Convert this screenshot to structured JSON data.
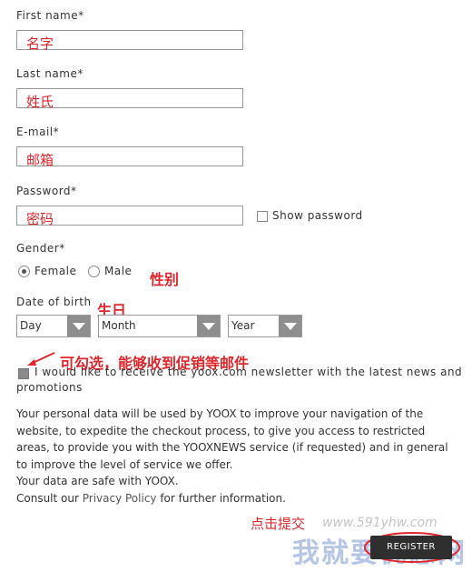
{
  "form": {
    "first_name": {
      "label": "First name*",
      "annotation": "名字"
    },
    "last_name": {
      "label": "Last name*",
      "annotation": "姓氏"
    },
    "email": {
      "label": "E-mail*",
      "annotation": "邮箱"
    },
    "password": {
      "label": "Password*",
      "annotation": "密码",
      "show_password_label": "Show password"
    },
    "gender": {
      "label": "Gender*",
      "options": [
        "Female",
        "Male"
      ],
      "selected": "Female",
      "annotation": "性别"
    },
    "dob": {
      "label": "Date of birth",
      "annotation": "生日",
      "day": "Day",
      "month": "Month",
      "year": "Year"
    },
    "newsletter": {
      "annotation": "可勾选，能够收到促销等邮件",
      "label_line1": "I would like to receive the yoox.com newsletter with the latest news and",
      "label_line2": "promotions"
    },
    "privacy": {
      "lines": [
        "Your personal data will be used by YOOX to improve your navigation of the",
        "website, to expedite the checkout process, to give you access to restricted",
        "areas, to provide you with the YOOXNEWS service (if requested) and in general",
        "to improve the level of service we offer.",
        "Your data are safe with YOOX."
      ],
      "consult_prefix": "Consult our ",
      "policy_link": "Privacy Policy",
      "consult_suffix": " for further information."
    },
    "submit": {
      "annotation": "点击提交",
      "label": "REGISTER"
    }
  },
  "watermark": {
    "text": "我就要优惠网",
    "url": "www.591yhw.com"
  },
  "colors": {
    "annotation_red": "#e0262b",
    "button": "#2f2f2f",
    "select_arrow": "#8e8e8e"
  }
}
